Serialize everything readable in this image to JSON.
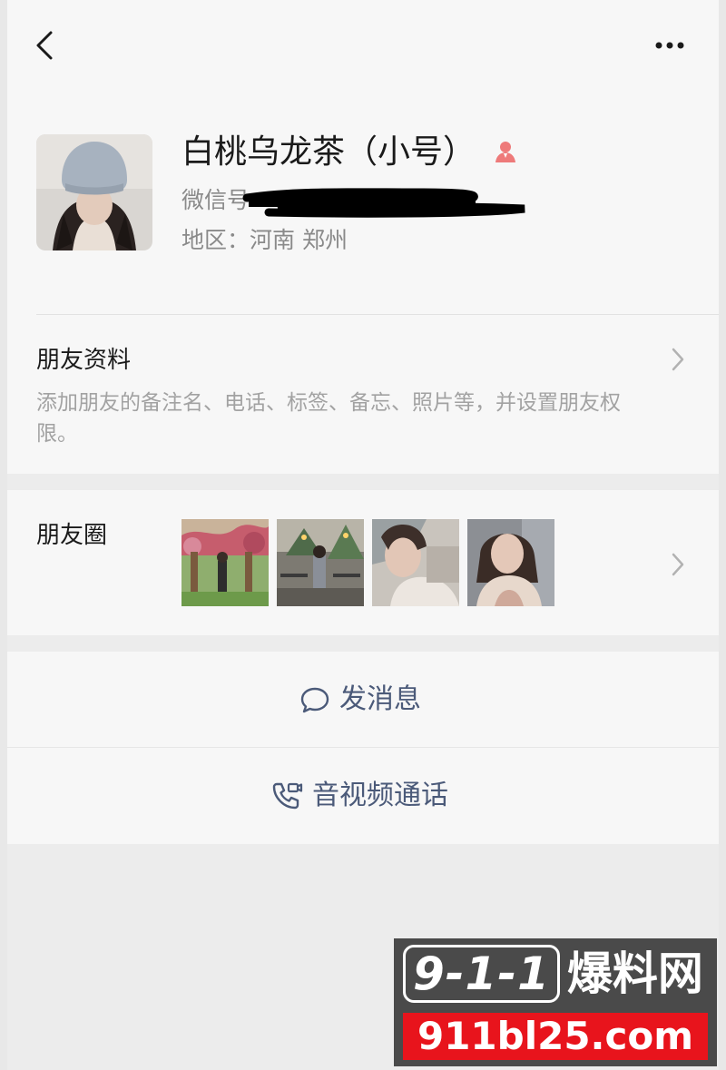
{
  "header": {
    "back_icon": "chevron-left-icon",
    "more_icon": "more-dots-icon"
  },
  "profile": {
    "name": "白桃乌龙茶（小号）",
    "name_badge_icon": "contact-person-icon",
    "wechat_id_label": "微信号",
    "region": "地区：河南 郑州"
  },
  "friend_profile": {
    "title": "朋友资料",
    "description": "添加朋友的备注名、电话、标签、备忘、照片等，并设置朋友权限。"
  },
  "moments": {
    "title": "朋友圈",
    "thumbnails": [
      "moment-photo-1",
      "moment-photo-2",
      "moment-photo-3",
      "moment-photo-4"
    ]
  },
  "actions": {
    "message_label": "发消息",
    "message_icon": "chat-bubble-icon",
    "call_label": "音视频通话",
    "call_icon": "phone-video-icon"
  },
  "watermark": {
    "brand_number": "9-1-1",
    "brand_text": "爆料网",
    "domain": "911bl25.com"
  },
  "colors": {
    "accent_text": "#4b5a79",
    "badge": "#e8141c"
  }
}
